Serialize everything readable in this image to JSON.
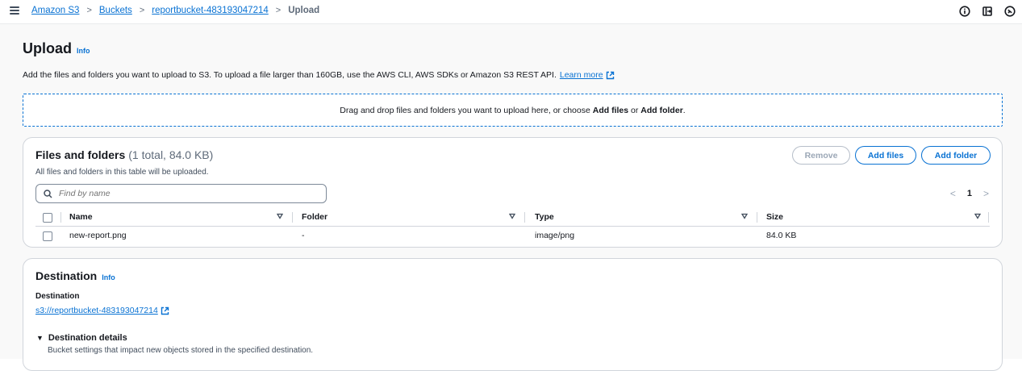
{
  "breadcrumbs": {
    "items": [
      "Amazon S3",
      "Buckets",
      "reportbucket-483193047214"
    ],
    "current": "Upload"
  },
  "page": {
    "title": "Upload",
    "info": "Info",
    "description": "Add the files and folders you want to upload to S3. To upload a file larger than 160GB, use the AWS CLI, AWS SDKs or Amazon S3 REST API.",
    "learn_more": "Learn more"
  },
  "dropzone": {
    "prefix": "Drag and drop files and folders you want to upload here, or choose",
    "add_files": "Add files",
    "or": "or",
    "add_folder": "Add folder",
    "suffix": "."
  },
  "files_panel": {
    "title": "Files and folders",
    "count": "(1 total, 84.0 KB)",
    "subtitle": "All files and folders in this table will be uploaded.",
    "remove_label": "Remove",
    "add_files_label": "Add files",
    "add_folder_label": "Add folder",
    "search_placeholder": "Find by name",
    "page_number": "1",
    "columns": [
      "Name",
      "Folder",
      "Type",
      "Size"
    ],
    "rows": [
      {
        "name": "new-report.png",
        "folder": "-",
        "type": "image/png",
        "size": "84.0 KB"
      }
    ]
  },
  "destination": {
    "title": "Destination",
    "info": "Info",
    "label": "Destination",
    "url": "s3://reportbucket-483193047214",
    "details_title": "Destination details",
    "details_desc": "Bucket settings that impact new objects stored in the specified destination."
  },
  "icons": {
    "menu": "hamburger-menu-icon",
    "info": "info-circle-icon",
    "notifications": "exit-panel-icon",
    "settings": "settings-circle-icon",
    "external": "external-link-icon",
    "search": "search-icon"
  },
  "colors": {
    "link": "#0972d3",
    "text": "#16191f",
    "border": "#d1d5db",
    "background": "#f9f9f9"
  }
}
